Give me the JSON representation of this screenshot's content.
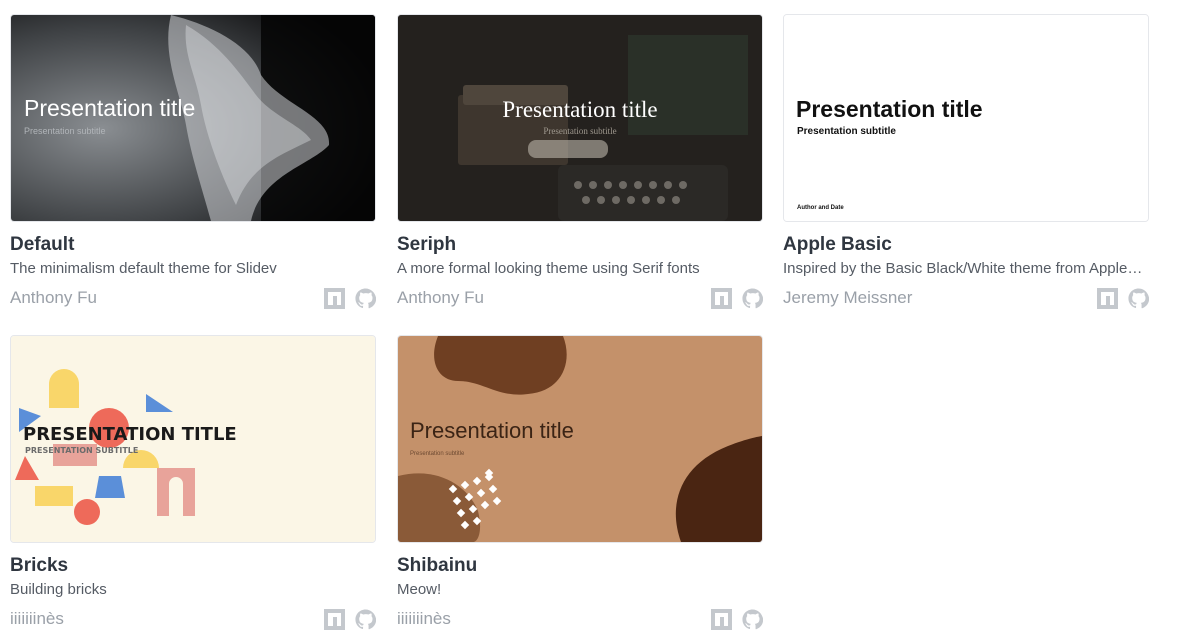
{
  "themes": [
    {
      "name": "Default",
      "description": "The minimalism default theme for Slidev",
      "author": "Anthony Fu",
      "preview_title": "Presentation title",
      "preview_subtitle": "Presentation subtitle"
    },
    {
      "name": "Seriph",
      "description": "A more formal looking theme using Serif fonts",
      "author": "Anthony Fu",
      "preview_title": "Presentation title",
      "preview_subtitle": "Presentation subtitle"
    },
    {
      "name": "Apple Basic",
      "description": "Inspired by the Basic Black/White theme from Apple Keynote",
      "author": "Jeremy Meissner",
      "preview_title": "Presentation title",
      "preview_subtitle": "Presentation subtitle",
      "preview_footer": "Author and Date"
    },
    {
      "name": "Bricks",
      "description": "Building bricks",
      "author": "iiiiiiinès",
      "preview_title": "PRESENTATION TITLE",
      "preview_subtitle": "PRESENTATION SUBTITLE"
    },
    {
      "name": "Shibainu",
      "description": "Meow!",
      "author": "iiiiiiinès",
      "preview_title": "Presentation title",
      "preview_subtitle": "Presentation subtitle"
    }
  ],
  "icons": {
    "npm": "npm-icon",
    "github": "github-icon"
  },
  "colors": {
    "title_text": "#2f3640",
    "muted_text": "#9aa0a8",
    "icon_gray": "#c4c8cd"
  }
}
